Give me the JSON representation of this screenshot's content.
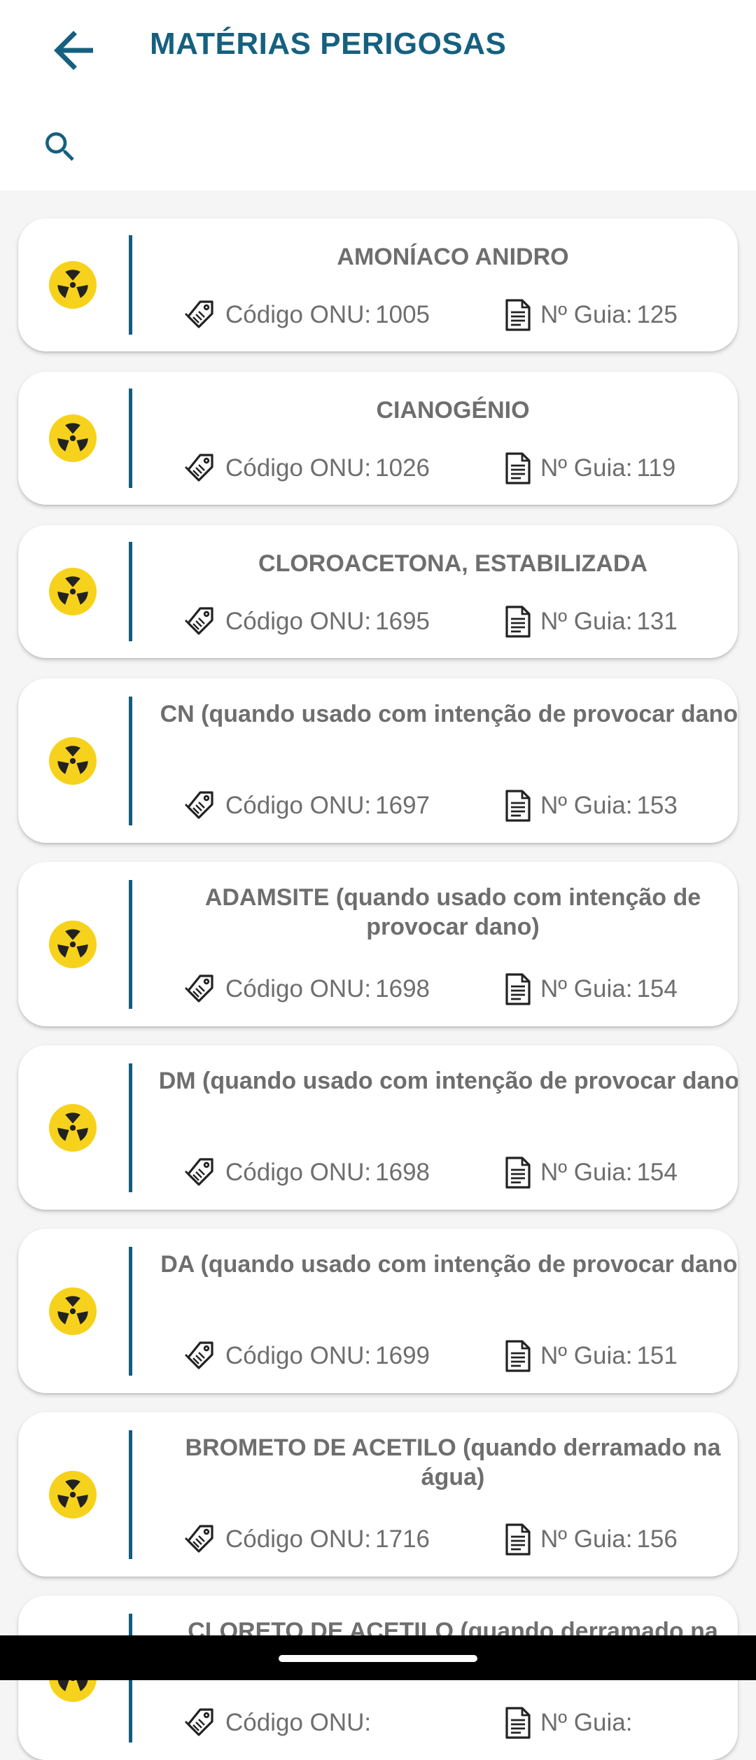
{
  "header": {
    "title": "MATÉRIAS PERIGOSAS",
    "back_icon": "arrow-left-icon",
    "search_icon": "search-icon"
  },
  "colors": {
    "accent": "#16607f",
    "hazard": "#f7d21c",
    "text": "#6e6e6e"
  },
  "labels": {
    "onu": "Código ONU:",
    "guide": "Nº Guia:"
  },
  "items": [
    {
      "name": "AMONÍACO ANIDRO",
      "onu": "1005",
      "guide": "125"
    },
    {
      "name": "CIANOGÉNIO",
      "onu": "1026",
      "guide": "119"
    },
    {
      "name": "CLOROACETONA, ESTABILIZADA",
      "onu": "1695",
      "guide": "131"
    },
    {
      "name": "CN (quando usado com intenção de provocar dano)",
      "onu": "1697",
      "guide": "153"
    },
    {
      "name": "ADAMSITE (quando usado com intenção de provocar dano)",
      "onu": "1698",
      "guide": "154"
    },
    {
      "name": "DM (quando usado com intenção de provocar dano)",
      "onu": "1698",
      "guide": "154"
    },
    {
      "name": "DA (quando usado com intenção de provocar dano)",
      "onu": "1699",
      "guide": "151"
    },
    {
      "name": "BROMETO DE ACETILO (quando derramado na água)",
      "onu": "1716",
      "guide": "156"
    },
    {
      "name": "CLORETO DE ACETILO (quando derramado na",
      "onu": "",
      "guide": ""
    }
  ]
}
